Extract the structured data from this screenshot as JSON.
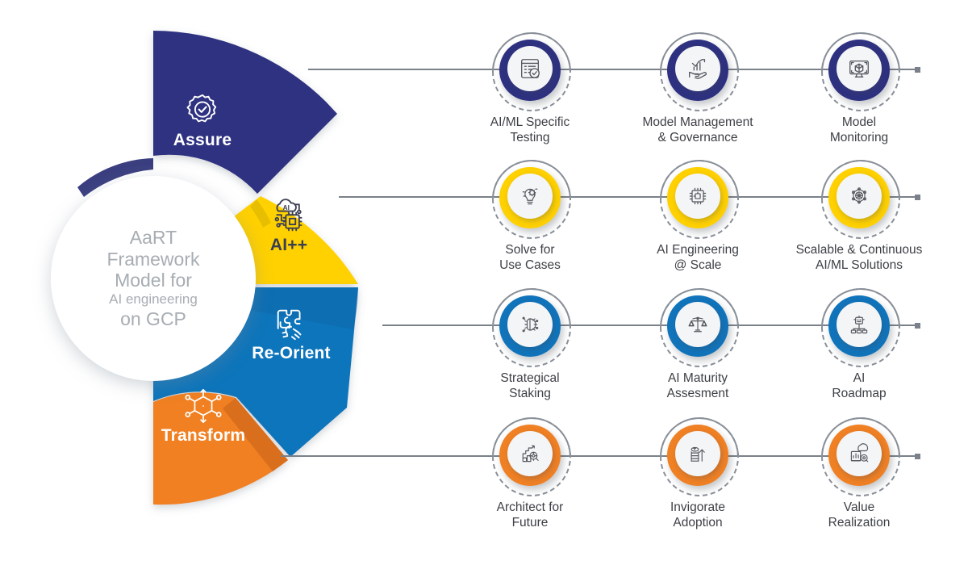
{
  "center": {
    "line1": "AaRT",
    "line2": "Framework",
    "line3": "Model for",
    "line4": "AI engineering",
    "line5": "on GCP"
  },
  "colors": {
    "assure": "#2E3180",
    "aiplusplus": "#FFD100",
    "reorient": "#1174BB",
    "transform": "#F08024",
    "line": "#7b8189",
    "label_text": "#3d4046",
    "center_text": "#a7adb3"
  },
  "wedges": [
    {
      "id": "assure",
      "label": "Assure",
      "icon": "verified-badge-icon",
      "color": "#2E3180",
      "text_color": "#ffffff"
    },
    {
      "id": "aiplusplus",
      "label": "AI++",
      "icon": "ai-chip-cloud-icon",
      "color": "#FFD100",
      "text_color": "#3b3f52"
    },
    {
      "id": "reorient",
      "label": "Re-Orient",
      "icon": "puzzle-hand-icon",
      "color": "#1174BB",
      "text_color": "#ffffff"
    },
    {
      "id": "transform",
      "label": "Transform",
      "icon": "network-cube-icon",
      "color": "#F08024",
      "text_color": "#ffffff"
    }
  ],
  "rows": [
    {
      "id": "assure-row",
      "color": "#2E3180",
      "nodes": [
        {
          "label": "AI/ML Specific\nTesting",
          "icon": "checklist-icon",
          "ring_style": "dashed-top"
        },
        {
          "label": "Model Management\n& Governance",
          "icon": "hand-growth-chart-icon",
          "ring_style": "dashed-bottom"
        },
        {
          "label": "Model\nMonitoring",
          "icon": "monitor-cube-icon",
          "ring_style": "dashed-top"
        }
      ]
    },
    {
      "id": "aiplusplus-row",
      "color": "#FFD100",
      "nodes": [
        {
          "label": "Solve for\nUse Cases",
          "icon": "lightbulb-gear-icon",
          "ring_style": "dashed-top"
        },
        {
          "label": "AI Engineering\n@ Scale",
          "icon": "cpu-chip-icon",
          "ring_style": "dashed-bottom"
        },
        {
          "label": "Scalable & Continuous\nAI/ML Solutions",
          "icon": "network-sphere-icon",
          "ring_style": "dashed-top"
        }
      ]
    },
    {
      "id": "reorient-row",
      "color": "#1174BB",
      "nodes": [
        {
          "label": "Strategical\nStaking",
          "icon": "gear-brain-icon",
          "ring_style": "dashed-top"
        },
        {
          "label": "AI Maturity\nAssesment",
          "icon": "balance-scale-icon",
          "ring_style": "dashed-bottom"
        },
        {
          "label": "AI\nRoadmap",
          "icon": "robot-hierarchy-icon",
          "ring_style": "dashed-top"
        }
      ]
    },
    {
      "id": "transform-row",
      "color": "#F08024",
      "nodes": [
        {
          "label": "Architect for\nFuture",
          "icon": "blueprint-gear-icon",
          "ring_style": "dashed-top"
        },
        {
          "label": "Invigorate\nAdoption",
          "icon": "coins-arrow-icon",
          "ring_style": "dashed-bottom"
        },
        {
          "label": "Value\nRealization",
          "icon": "cloud-analytics-icon",
          "ring_style": "dashed-top"
        }
      ]
    }
  ]
}
